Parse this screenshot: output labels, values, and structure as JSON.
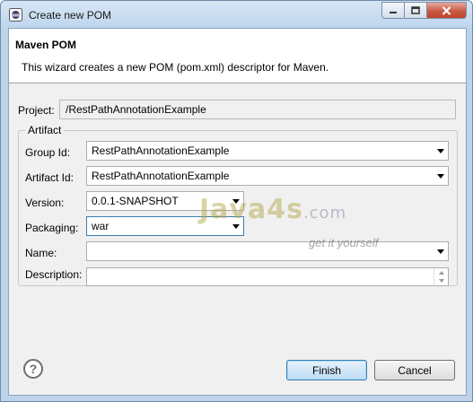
{
  "window": {
    "title": "Create new POM"
  },
  "header": {
    "title": "Maven POM",
    "description": "This wizard creates a new POM (pom.xml) descriptor for Maven."
  },
  "project": {
    "label": "Project:",
    "value": "/RestPathAnnotationExample"
  },
  "artifact": {
    "group_title": "Artifact",
    "group_id": {
      "label": "Group Id:",
      "value": "RestPathAnnotationExample"
    },
    "artifact_id": {
      "label": "Artifact Id:",
      "value": "RestPathAnnotationExample"
    },
    "version": {
      "label": "Version:",
      "value": "0.0.1-SNAPSHOT"
    },
    "packaging": {
      "label": "Packaging:",
      "value": "war"
    },
    "name": {
      "label": "Name:",
      "value": ""
    },
    "description": {
      "label": "Description:",
      "value": ""
    }
  },
  "watermark": {
    "brand": "Java4s",
    "domain": ".com",
    "tagline": "get it yourself"
  },
  "buttons": {
    "finish": "Finish",
    "cancel": "Cancel"
  },
  "colors": {
    "finish_accent": "#3c7fb1",
    "close_button": "#c75a45"
  }
}
